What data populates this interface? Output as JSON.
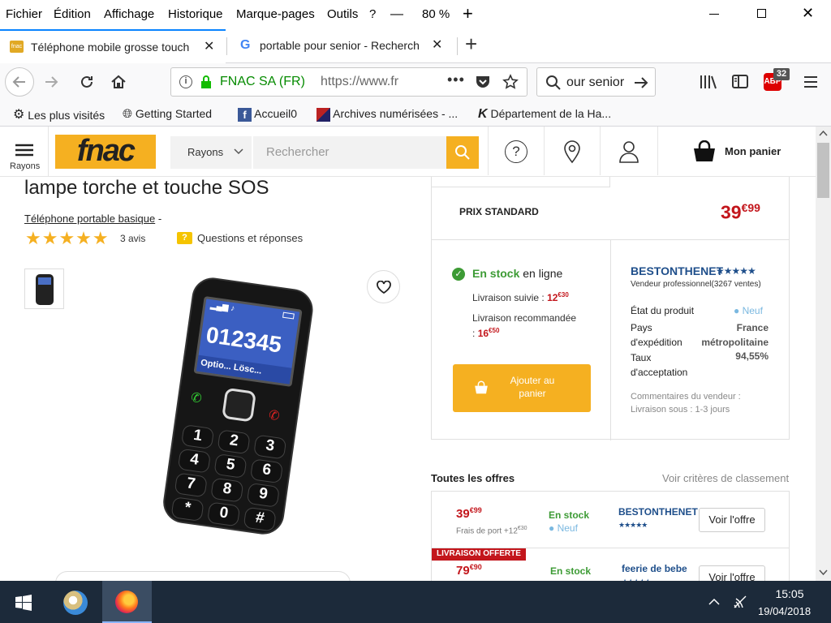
{
  "menubar": {
    "items": [
      "Fichier",
      "Édition",
      "Affichage",
      "Historique",
      "Marque-pages",
      "Outils",
      "?"
    ],
    "zoom": "80 %",
    "minus": "—",
    "plus": "+"
  },
  "tabs": [
    {
      "title": "Téléphone mobile grosse touch",
      "active": true
    },
    {
      "title": "portable pour senior - Recherch",
      "active": false
    }
  ],
  "navbar": {
    "site_identity": "FNAC SA (FR)",
    "url": "https://www.fr",
    "search_value": "our senior",
    "badge_count": "32"
  },
  "bookmarks": [
    "Les plus visités",
    "Getting Started",
    "Accueil0",
    "Archives numérisées - ...",
    "Département de la Ha..."
  ],
  "header": {
    "logo": "fnac",
    "rayons_label": "Rayons",
    "rayons_dropdown": "Rayons",
    "search_placeholder": "Rechercher",
    "cart_label": "Mon panier"
  },
  "product": {
    "title": "lampe torche et touche SOS",
    "category": "Téléphone portable basique",
    "separator": "-",
    "stars": "★★★★★",
    "reviews": "3 avis",
    "qa_label": "Questions et réponses",
    "phone_number": "012345",
    "phone_softkeys": "Optio... Lösc..."
  },
  "buybox": {
    "standard_label": "PRIX STANDARD",
    "price_main": "39",
    "price_cents": "€99",
    "stock": "En stock",
    "stock_suffix": "en ligne",
    "delivery1_label": "Livraison suivie :",
    "delivery1_price": "12",
    "delivery1_cents": "€30",
    "delivery2_label": "Livraison recommandée",
    "delivery2_prefix": ":",
    "delivery2_price": "16",
    "delivery2_cents": "€50",
    "add_to_cart": "Ajouter au panier"
  },
  "seller": {
    "name": "BESTONTHENET",
    "stars": "★★★★★",
    "type": "Vendeur professionnel",
    "sales": "(3267 ventes)",
    "state_label": "État du produit",
    "state_value": "Neuf",
    "ship_label_1": "Pays",
    "ship_label_2": "d'expédition",
    "ship_value_1": "France",
    "ship_value_2": "métropolitaine",
    "rate_label_1": "Taux",
    "rate_label_2": "d'acceptation",
    "rate_value": "94,55%",
    "comments_1": "Commentaires du vendeur :",
    "comments_2": "Livraison sous : 1-3 jours"
  },
  "offers": {
    "title": "Toutes les offres",
    "criteria_link": "Voir critères de classement",
    "rows": [
      {
        "price": "39",
        "cents": "€99",
        "shipping": "Frais de port +12",
        "shipping_cents": "€30",
        "stock": "En stock",
        "state": "Neuf",
        "seller": "BESTONTHENET",
        "stars": "★★★★★",
        "button": "Voir l'offre",
        "badge": ""
      },
      {
        "price": "79",
        "cents": "€90",
        "shipping": "",
        "shipping_cents": "",
        "stock": "En stock",
        "state": "",
        "seller": "feerie de bebe",
        "stars": "★★★★★",
        "button": "Voir l'offre",
        "badge": "LIVRAISON OFFERTE"
      }
    ]
  },
  "taskbar": {
    "time": "15:05",
    "date": "19/04/2018"
  },
  "colors": {
    "fnac_yellow": "#f5b021",
    "price_red": "#c3161c",
    "seller_blue": "#1f4f8b",
    "stock_green": "#3d9b35",
    "taskbar": "#1c2a3a"
  }
}
